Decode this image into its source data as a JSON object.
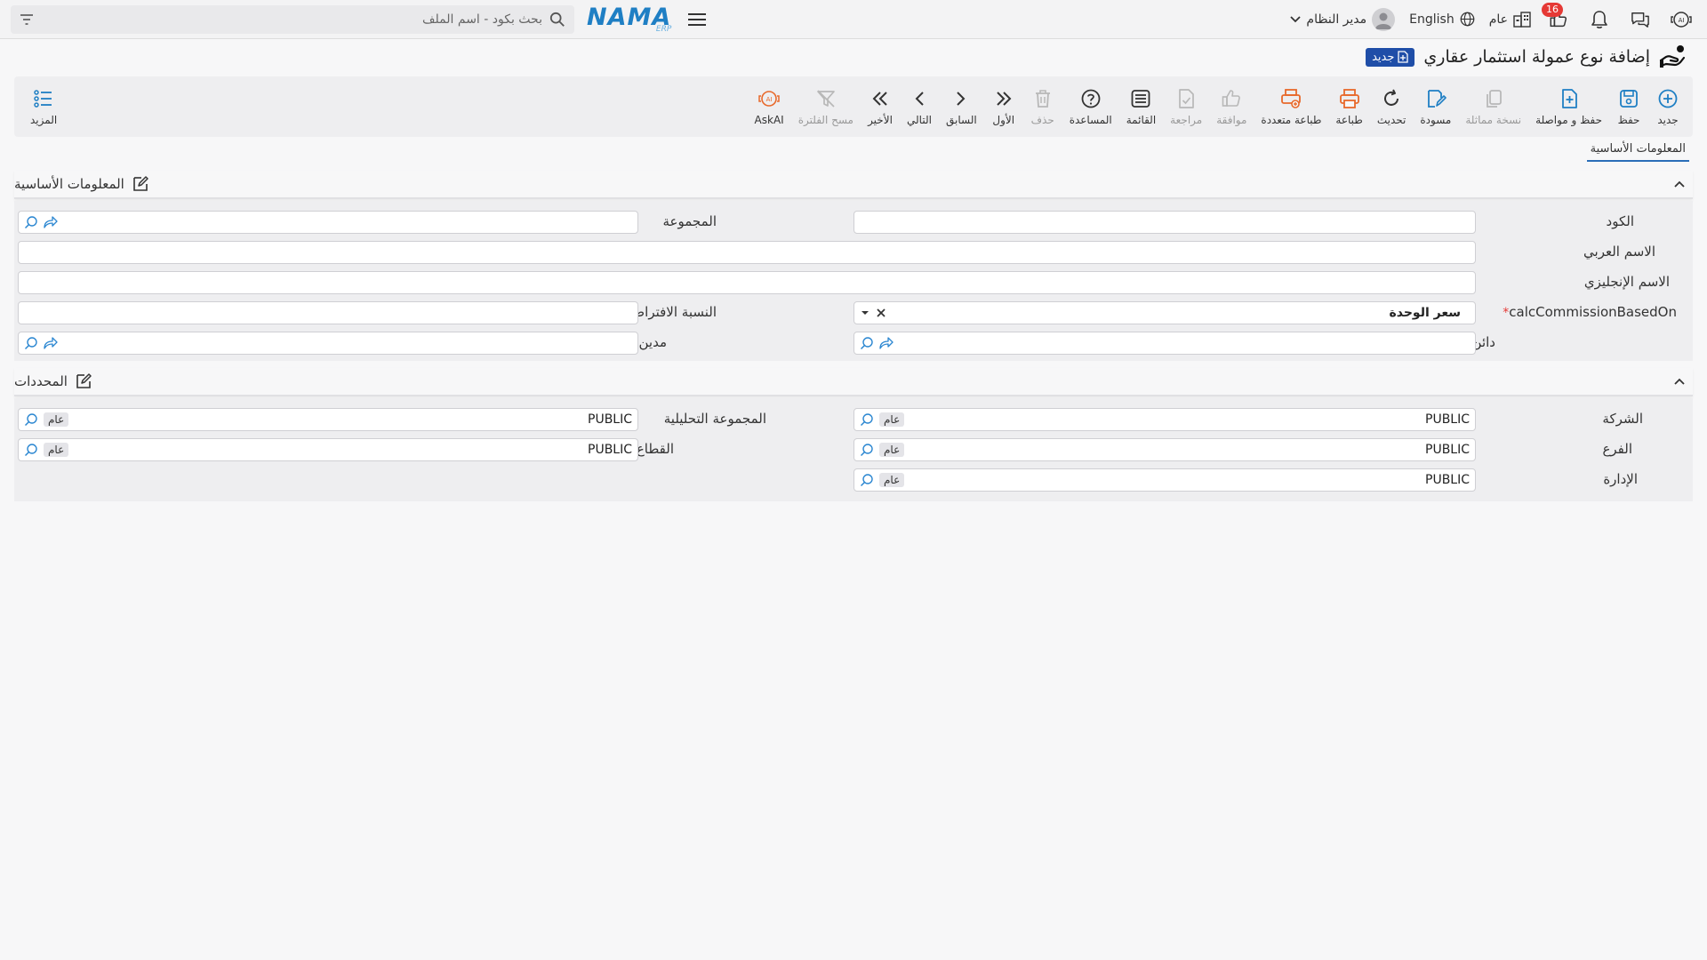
{
  "header": {
    "logo_text": "NAMA",
    "logo_sub": "ERP",
    "search_placeholder": "بحث بكود - اسم الملف",
    "notification_count": "16",
    "branch_label": "عام",
    "language_label": "English",
    "user_name": "مدير النظام"
  },
  "page": {
    "title": "إضافة نوع عمولة استثمار عقاري",
    "badge": "جديد"
  },
  "toolbar": {
    "items": [
      {
        "label": "جديد",
        "icon": "plus-circle-icon",
        "color": "#1f7fc4",
        "enabled": true
      },
      {
        "label": "حفظ",
        "icon": "save-icon",
        "color": "#1f7fc4",
        "enabled": true
      },
      {
        "label": "حفظ و مواصلة",
        "icon": "save-continue-icon",
        "color": "#1f7fc4",
        "enabled": true
      },
      {
        "label": "نسخة مماثلة",
        "icon": "copy-icon",
        "color": "#b8b8b8",
        "enabled": false
      },
      {
        "label": "مسودة",
        "icon": "draft-icon",
        "color": "#1f7fc4",
        "enabled": true
      },
      {
        "label": "تحديث",
        "icon": "refresh-icon",
        "color": "#333333",
        "enabled": true
      },
      {
        "label": "طباعة",
        "icon": "print-icon",
        "color": "#e8692b",
        "enabled": true
      },
      {
        "label": "طباعة متعددة",
        "icon": "multi-print-icon",
        "color": "#e8692b",
        "enabled": true
      },
      {
        "label": "موافقة",
        "icon": "thumbs-up-icon",
        "color": "#b8b8b8",
        "enabled": false
      },
      {
        "label": "مراجعة",
        "icon": "review-icon",
        "color": "#b8b8b8",
        "enabled": false
      },
      {
        "label": "القائمة",
        "icon": "list-icon",
        "color": "#333333",
        "enabled": true
      },
      {
        "label": "المساعدة",
        "icon": "help-icon",
        "color": "#333333",
        "enabled": true
      },
      {
        "label": "حذف",
        "icon": "trash-icon",
        "color": "#b8b8b8",
        "enabled": false
      },
      {
        "label": "الأول",
        "icon": "first-icon",
        "color": "#333333",
        "enabled": true
      },
      {
        "label": "السابق",
        "icon": "previous-icon",
        "color": "#333333",
        "enabled": true
      },
      {
        "label": "التالي",
        "icon": "next-icon",
        "color": "#333333",
        "enabled": true
      },
      {
        "label": "الأخير",
        "icon": "last-icon",
        "color": "#333333",
        "enabled": true
      },
      {
        "label": "مسح الفلترة",
        "icon": "clear-filter-icon",
        "color": "#b8b8b8",
        "enabled": false
      },
      {
        "label": "AskAI",
        "icon": "ask-ai-icon",
        "color": "#e8692b",
        "enabled": true
      }
    ],
    "more_label": "المزيد"
  },
  "tabs": {
    "active": "المعلومات الأساسية"
  },
  "basic_section": {
    "title": "المعلومات الأساسية",
    "code_label": "الكود",
    "code_value": "",
    "group_label": "المجموعة",
    "group_value": "",
    "arabic_name_label": "الاسم العربي",
    "arabic_name_value": "",
    "english_name_label": "الاسم الإنجليزي",
    "english_name_value": "",
    "calc_label": "calcCommissionBasedOn",
    "calc_value": "سعر الوحدة",
    "default_ratio_label": "النسبة الافتراضية",
    "default_ratio_value": "",
    "creditor_label": "دائن",
    "creditor_value": "",
    "debtor_label": "مدين",
    "debtor_value": ""
  },
  "dimensions_section": {
    "title": "المحددات",
    "company_label": "الشركة",
    "company_value": "PUBLIC",
    "company_tag": "عام",
    "analytic_group_label": "المجموعة التحليلية",
    "analytic_group_value": "PUBLIC",
    "analytic_group_tag": "عام",
    "branch_label": "الفرع",
    "branch_value": "PUBLIC",
    "branch_tag": "عام",
    "sector_label": "القطاع",
    "sector_value": "PUBLIC",
    "sector_tag": "عام",
    "department_label": "الإدارة",
    "department_value": "PUBLIC",
    "department_tag": "عام"
  },
  "colors": {
    "brand": "#1f7fc4",
    "badge": "#1f4ea8",
    "danger": "#e53935",
    "accent_orange": "#e8692b"
  }
}
